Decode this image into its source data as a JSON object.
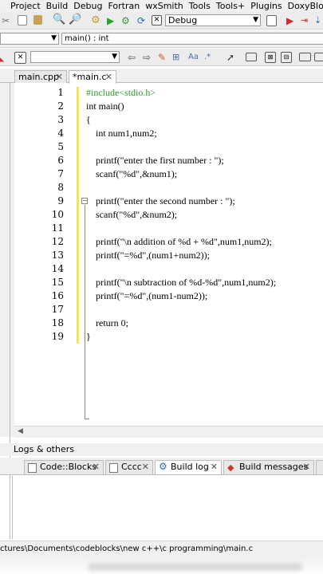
{
  "menu": [
    "Project",
    "Build",
    "Debug",
    "Fortran",
    "wxSmith",
    "Tools",
    "Tools+",
    "Plugins",
    "DoxyBlo"
  ],
  "build_target": "Debug",
  "scope": {
    "function": "main() : int"
  },
  "tabs": [
    {
      "label": "main.cpp",
      "active": false
    },
    {
      "label": "*main.c",
      "active": true
    }
  ],
  "code": {
    "line_numbers": [
      "1",
      "2",
      "3",
      "4",
      "5",
      "6",
      "7",
      "8",
      "9",
      "10",
      "11",
      "12",
      "13",
      "14",
      "15",
      "16",
      "17",
      "18",
      "19"
    ],
    "lines": [
      "#include<stdio.h>",
      "int main()",
      "{",
      "    int num1,num2;",
      "",
      "    printf(\"enter the first number : \");",
      "    scanf(\"%d\",&num1);",
      "",
      "    printf(\"enter the second number : \");",
      "    scanf(\"%d\",&num2);",
      "",
      "    printf(\"\\n addition of %d + %d\",num1,num2);",
      "    printf(\"=%d\",(num1+num2));",
      "",
      "    printf(\"\\n subtraction of %d-%d\",num1,num2);",
      "    printf(\"=%d\",(num1-num2));",
      "",
      "    return 0;",
      "}"
    ]
  },
  "logs": {
    "title": "Logs & others",
    "tabs": [
      {
        "label": "Code::Blocks",
        "active": false
      },
      {
        "label": "Cccc",
        "active": false
      },
      {
        "label": "Build log",
        "active": true
      },
      {
        "label": "Build messages",
        "active": false
      }
    ]
  },
  "status": {
    "path": "ctures\\Documents\\codeblocks\\new c++\\c programming\\main.c"
  },
  "colors": {
    "change_bar": "#f2e64a",
    "preprocessor": "#2a9a2a",
    "string": "#0000c8"
  }
}
